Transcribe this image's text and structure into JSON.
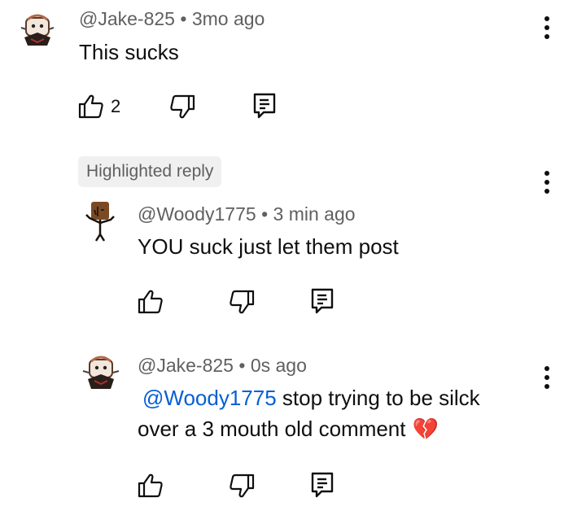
{
  "comment": {
    "author": "@Jake-825",
    "time": "3mo ago",
    "text": "This sucks",
    "like_count": "2"
  },
  "highlighted_label": "Highlighted reply",
  "reply1": {
    "author": "@Woody1775",
    "time": "3 min ago",
    "text": "YOU suck just let them post"
  },
  "reply2": {
    "author": "@Jake-825",
    "time": "0s ago",
    "mention": "@Woody1775",
    "text_line1": " stop trying to be silck",
    "text_line2": "over a 3 mouth old comment",
    "emoji": "💔"
  },
  "separator": "•",
  "icons": {
    "like": "thumbs-up-icon",
    "dislike": "thumbs-down-icon",
    "reply": "reply-comment-icon",
    "more": "more-vertical-icon"
  },
  "colors": {
    "meta_text": "#606060",
    "mention_link": "#065fd4",
    "chip_bg": "#f0f0f0"
  }
}
